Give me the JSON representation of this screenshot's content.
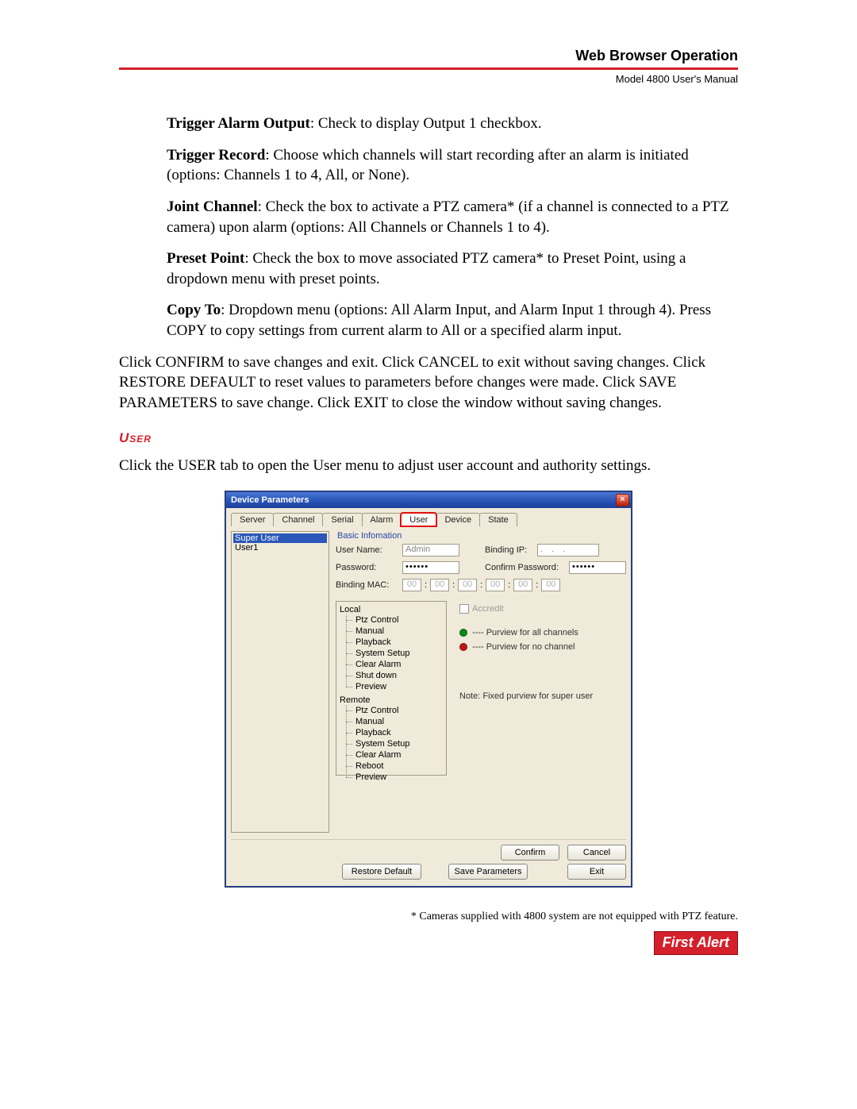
{
  "header": {
    "title": "Web Browser Operation",
    "subtitle": "Model 4800 User's Manual"
  },
  "paragraphs": {
    "p1_label": "Trigger Alarm Output",
    "p1_text": ": Check to display Output 1 checkbox.",
    "p2_label": "Trigger Record",
    "p2_text": ": Choose which channels will start recording after an alarm is initiated (options: Channels 1 to 4, All, or None).",
    "p3_label": "Joint Channel",
    "p3_text": ": Check the box to activate a PTZ camera* (if a channel is connected to a PTZ camera) upon alarm (options: All Channels or Channels 1 to 4).",
    "p4_label": "Preset Point",
    "p4_text": ": Check the box to move associated PTZ camera* to Preset Point, using a dropdown menu with preset points.",
    "p5_label": "Copy To",
    "p5_text": ":  Dropdown menu (options: All Alarm Input, and Alarm Input 1 through 4). Press COPY to copy settings from current alarm to All or a specified alarm input.",
    "p6": "Click CONFIRM to save changes and exit. Click CANCEL to exit without saving changes. Click RESTORE DEFAULT to reset values to parameters before changes were made. Click SAVE PARAMETERS to save change. Click EXIT to close the window without saving changes.",
    "user_heading": "User",
    "p7": "Click the USER tab to open the User menu to adjust user account and authority settings."
  },
  "dialog": {
    "title": "Device Parameters",
    "close": "×",
    "tabs": [
      "Server",
      "Channel",
      "Serial",
      "Alarm",
      "User",
      "Device",
      "State"
    ],
    "active_tab_index": 4,
    "userlist": [
      "Super User",
      "User1"
    ],
    "userlist_selected_index": 0,
    "group_basic": "Basic Infomation",
    "labels": {
      "username": "User Name:",
      "password": "Password:",
      "binding_mac": "Binding MAC:",
      "binding_ip": "Binding IP:",
      "confirm_pw": "Confirm Password:"
    },
    "values": {
      "username": "Admin",
      "password": "••••••",
      "confirm_pw": "••••••",
      "ip": ".   .   .",
      "mac": [
        "00",
        "00",
        "00",
        "00",
        "00",
        "00"
      ]
    },
    "tree": {
      "local_label": "Local",
      "local": [
        "Ptz Control",
        "Manual",
        "Playback",
        "System Setup",
        "Clear Alarm",
        "Shut down",
        "Preview"
      ],
      "remote_label": "Remote",
      "remote": [
        "Ptz Control",
        "Manual",
        "Playback",
        "System Setup",
        "Clear Alarm",
        "Reboot",
        "Preview"
      ]
    },
    "right": {
      "accredit": "Accredit",
      "purview_all": "---- Purview for all channels",
      "purview_none": "---- Purview for no channel",
      "note": "Note: Fixed purview for super user"
    },
    "buttons": {
      "confirm": "Confirm",
      "cancel": "Cancel",
      "restore": "Restore Default",
      "save": "Save Parameters",
      "exit": "Exit"
    }
  },
  "footnote": "* Cameras supplied with 4800 system are not equipped with PTZ feature.",
  "logo_text": "First Alert"
}
